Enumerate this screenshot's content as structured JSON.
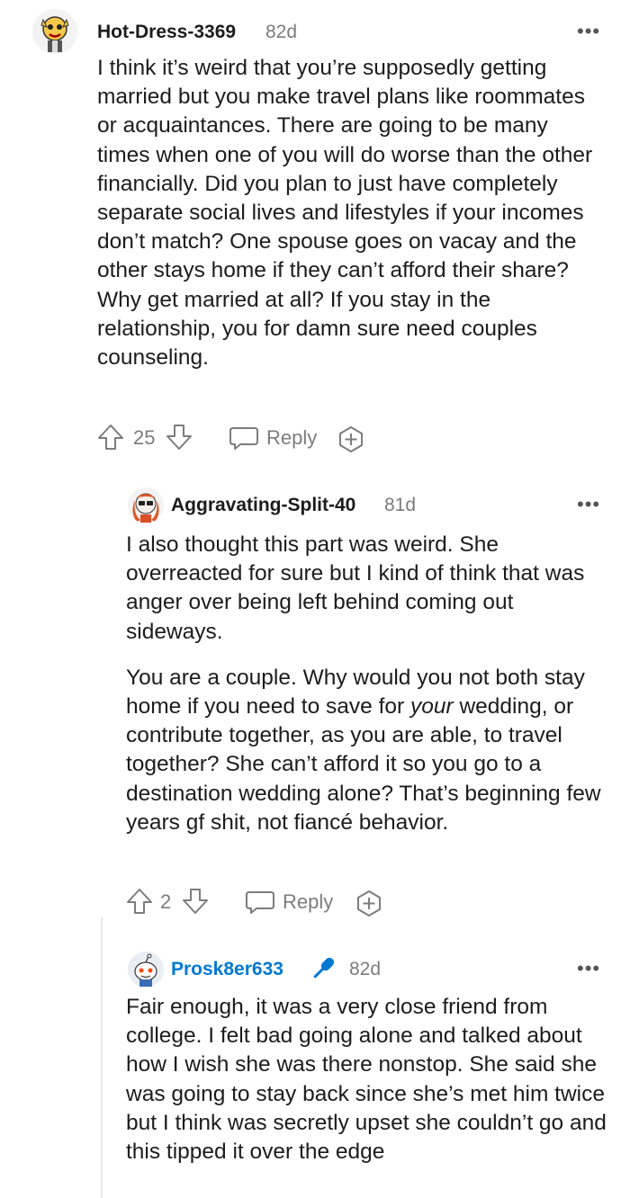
{
  "comments": [
    {
      "author": "Hot-Dress-3369",
      "age": "82d",
      "paragraphs": [
        "I think it’s weird that you’re supposedly getting married but you make travel plans like roommates or acquaintances. There are going to be many times when one of you will do worse than the other financially. Did you plan to just have completely separate social lives and lifestyles if your incomes don’t match? One spouse goes on vacay and the other stays home if they can’t afford their share? Why get married at all? If you stay in the relationship, you for damn sure need couples counseling."
      ],
      "votes": "25",
      "reply_label": "Reply"
    },
    {
      "author": "Aggravating-Split-40",
      "age": "81d",
      "paragraphs": [
        "I also thought this part was weird. She overreacted for sure but I kind of think that was anger over being left behind coming out sideways.",
        "You are a couple. Why would you not both stay home if you need to save for ",
        "your",
        " wedding, or contribute together, as you are able, to travel together? She can’t afford it so you go to a destination wedding alone? That’s beginning few years gf shit, not fiancé behavior."
      ],
      "votes": "2",
      "reply_label": "Reply"
    },
    {
      "author": "Prosk8er633",
      "age": "82d",
      "paragraphs": [
        "Fair enough, it was a very close friend from college. I felt bad going alone and talked about how I wish she was there nonstop. She said she was going to stay back since she’s met him twice but I think was secretly upset she couldn’t go and this tipped it over the edge"
      ]
    }
  ],
  "colors": {
    "op_accent": "#0079d3",
    "meta": "#7c7c7c",
    "text": "#1c1c1c"
  }
}
